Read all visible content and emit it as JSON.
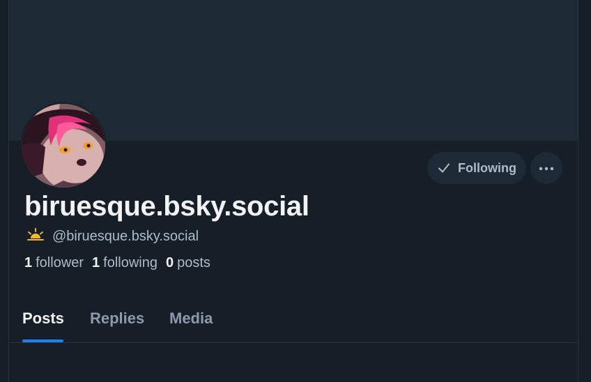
{
  "profile": {
    "display_name": "biruesque.bsky.social",
    "handle": "@biruesque.bsky.social",
    "handle_icon": "sun-horizon-icon",
    "follow_button_label": "Following",
    "more_icon": "more-dots-icon"
  },
  "stats": {
    "followers_count": "1",
    "followers_label": "follower",
    "following_count": "1",
    "following_label": "following",
    "posts_count": "0",
    "posts_label": "posts"
  },
  "tabs": [
    {
      "label": "Posts",
      "active": true
    },
    {
      "label": "Replies",
      "active": false
    },
    {
      "label": "Media",
      "active": false
    }
  ],
  "colors": {
    "accent": "#1e80f0",
    "background": "#161e27",
    "banner": "#1e2936"
  }
}
